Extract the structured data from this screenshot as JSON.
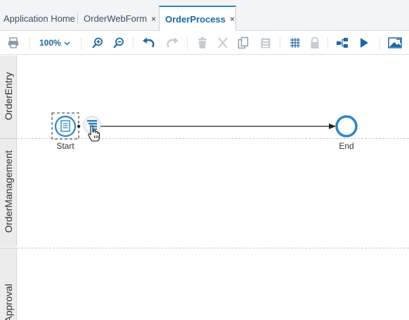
{
  "tabs": [
    {
      "label": "Application Home",
      "closable": false,
      "active": false
    },
    {
      "label": "OrderWebForm",
      "closable": true,
      "active": false
    },
    {
      "label": "OrderProcess",
      "closable": true,
      "active": true
    }
  ],
  "close_glyph": "×",
  "toolbar": {
    "zoom_level": "100%",
    "icons": [
      "print-icon",
      "zoom-in-icon",
      "zoom-out-icon",
      "undo-icon",
      "redo-icon",
      "delete-icon",
      "cut-icon",
      "copy-icon",
      "paste-icon",
      "grid-icon",
      "lock-icon",
      "auto-layout-icon",
      "run-icon",
      "image-export-icon"
    ]
  },
  "lanes": [
    {
      "label": "OrderEntry"
    },
    {
      "label": "OrderManagement"
    },
    {
      "label": "Approval"
    }
  ],
  "nodes": {
    "start_label": "Start",
    "end_label": "End"
  },
  "colors": {
    "accent": "#2b86c8",
    "tab_text": "#3c4f67",
    "active_tab_text": "#1f66a3",
    "lane_header_bg": "#ececec",
    "icon_disabled": "#c4cbd2"
  }
}
